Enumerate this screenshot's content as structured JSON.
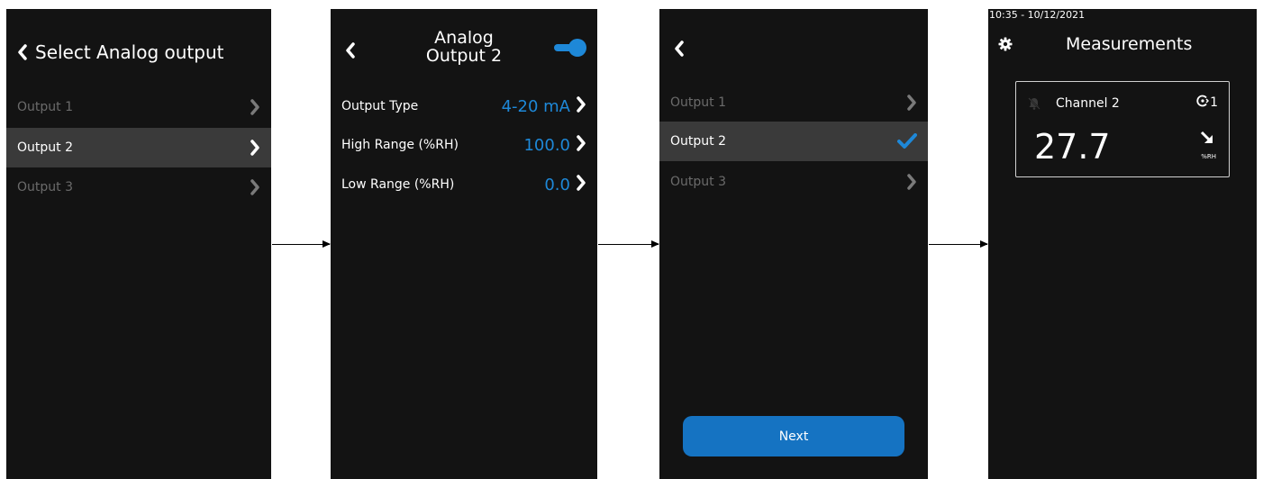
{
  "screen1": {
    "title": "Select Analog output",
    "items": [
      {
        "label": "Output 1"
      },
      {
        "label": "Output 2"
      },
      {
        "label": "Output 3"
      }
    ]
  },
  "screen2": {
    "title_line1": "Analog",
    "title_line2": "Output 2",
    "toggle_on": true,
    "settings": [
      {
        "label": "Output Type",
        "value": "4-20 mA"
      },
      {
        "label": "High Range (%RH)",
        "value": "100.0"
      },
      {
        "label": "Low Range (%RH)",
        "value": "0.0"
      }
    ]
  },
  "screen3": {
    "items": [
      {
        "label": "Output 1"
      },
      {
        "label": "Output 2"
      },
      {
        "label": "Output 3"
      }
    ],
    "next_label": "Next"
  },
  "screen4": {
    "timestamp": "10:35 - 10/12/2021",
    "title": "Measurements",
    "card": {
      "channel": "Channel 2",
      "value": "27.7",
      "unit": "%RH",
      "output_number": "1"
    }
  },
  "colors": {
    "accent": "#1e88d8",
    "button": "#1573c2",
    "background": "#131313",
    "selected_row": "#3a3a3a",
    "dim_text": "#6b6b6b"
  },
  "icons": [
    "chevron-left-icon",
    "chevron-right-icon",
    "toggle-switch",
    "check-icon",
    "gear-icon",
    "bell-muted-icon",
    "output-icon",
    "trend-down-right-icon"
  ]
}
